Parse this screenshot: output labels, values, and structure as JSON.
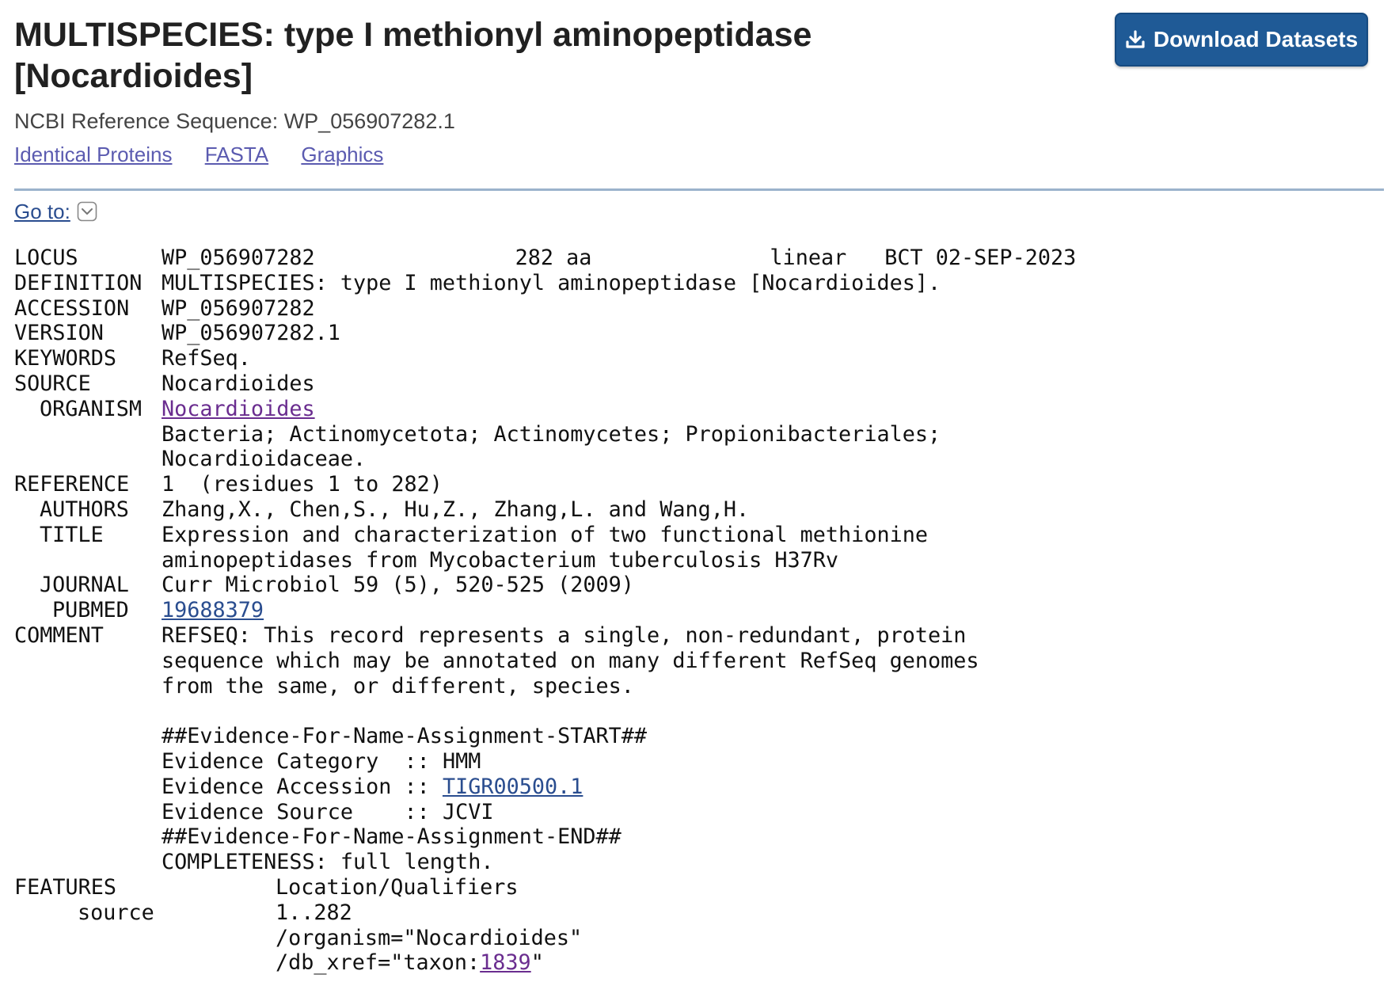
{
  "header": {
    "title": "MULTISPECIES: type I methionyl aminopeptidase [Nocardioides]",
    "refseq_label": "NCBI Reference Sequence: WP_056907282.1",
    "links": [
      "Identical Proteins",
      "FASTA",
      "Graphics"
    ],
    "download_button": "Download Datasets",
    "goto_label": "Go to:"
  },
  "record": {
    "locus": {
      "key": "LOCUS",
      "name": "WP_056907282",
      "length": "282 aa",
      "topology": "linear",
      "division_date": "BCT 02-SEP-2023"
    },
    "definition": {
      "key": "DEFINITION",
      "value": "MULTISPECIES: type I methionyl aminopeptidase [Nocardioides]."
    },
    "accession": {
      "key": "ACCESSION",
      "value": "WP_056907282"
    },
    "version": {
      "key": "VERSION",
      "value": "WP_056907282.1"
    },
    "keywords": {
      "key": "KEYWORDS",
      "value": "RefSeq."
    },
    "source": {
      "key": "SOURCE",
      "value": "Nocardioides"
    },
    "organism": {
      "key": "ORGANISM",
      "link": "Nocardioides",
      "lineage1": "Bacteria; Actinomycetota; Actinomycetes; Propionibacteriales;",
      "lineage2": "Nocardioidaceae."
    },
    "reference": {
      "key": "REFERENCE",
      "value": "1  (residues 1 to 282)",
      "authors_key": "AUTHORS",
      "authors": "Zhang,X., Chen,S., Hu,Z., Zhang,L. and Wang,H.",
      "title_key": "TITLE",
      "title1": "Expression and characterization of two functional methionine",
      "title2": "aminopeptidases from Mycobacterium tuberculosis H37Rv",
      "journal_key": "JOURNAL",
      "journal": "Curr Microbiol 59 (5), 520-525 (2009)",
      "pubmed_key": "PUBMED",
      "pubmed": "19688379"
    },
    "comment": {
      "key": "COMMENT",
      "line1": "REFSEQ: This record represents a single, non-redundant, protein",
      "line2": "sequence which may be annotated on many different RefSeq genomes",
      "line3": "from the same, or different, species.",
      "evidence_start": "##Evidence-For-Name-Assignment-START##",
      "category_label": "Evidence Category  :: ",
      "category_value": "HMM",
      "accession_label": "Evidence Accession :: ",
      "accession_link": "TIGR00500.1",
      "source_label": "Evidence Source    :: ",
      "source_value": "JCVI",
      "evidence_end": "##Evidence-For-Name-Assignment-END##",
      "completeness": "COMPLETENESS: full length."
    },
    "features": {
      "key": "FEATURES",
      "header": "Location/Qualifiers",
      "source_key": "source",
      "location": "1..282",
      "organism_qual": "/organism=\"Nocardioides\"",
      "xref_prefix": "/db_xref=\"taxon:",
      "xref_link": "1839",
      "xref_suffix": "\""
    }
  }
}
